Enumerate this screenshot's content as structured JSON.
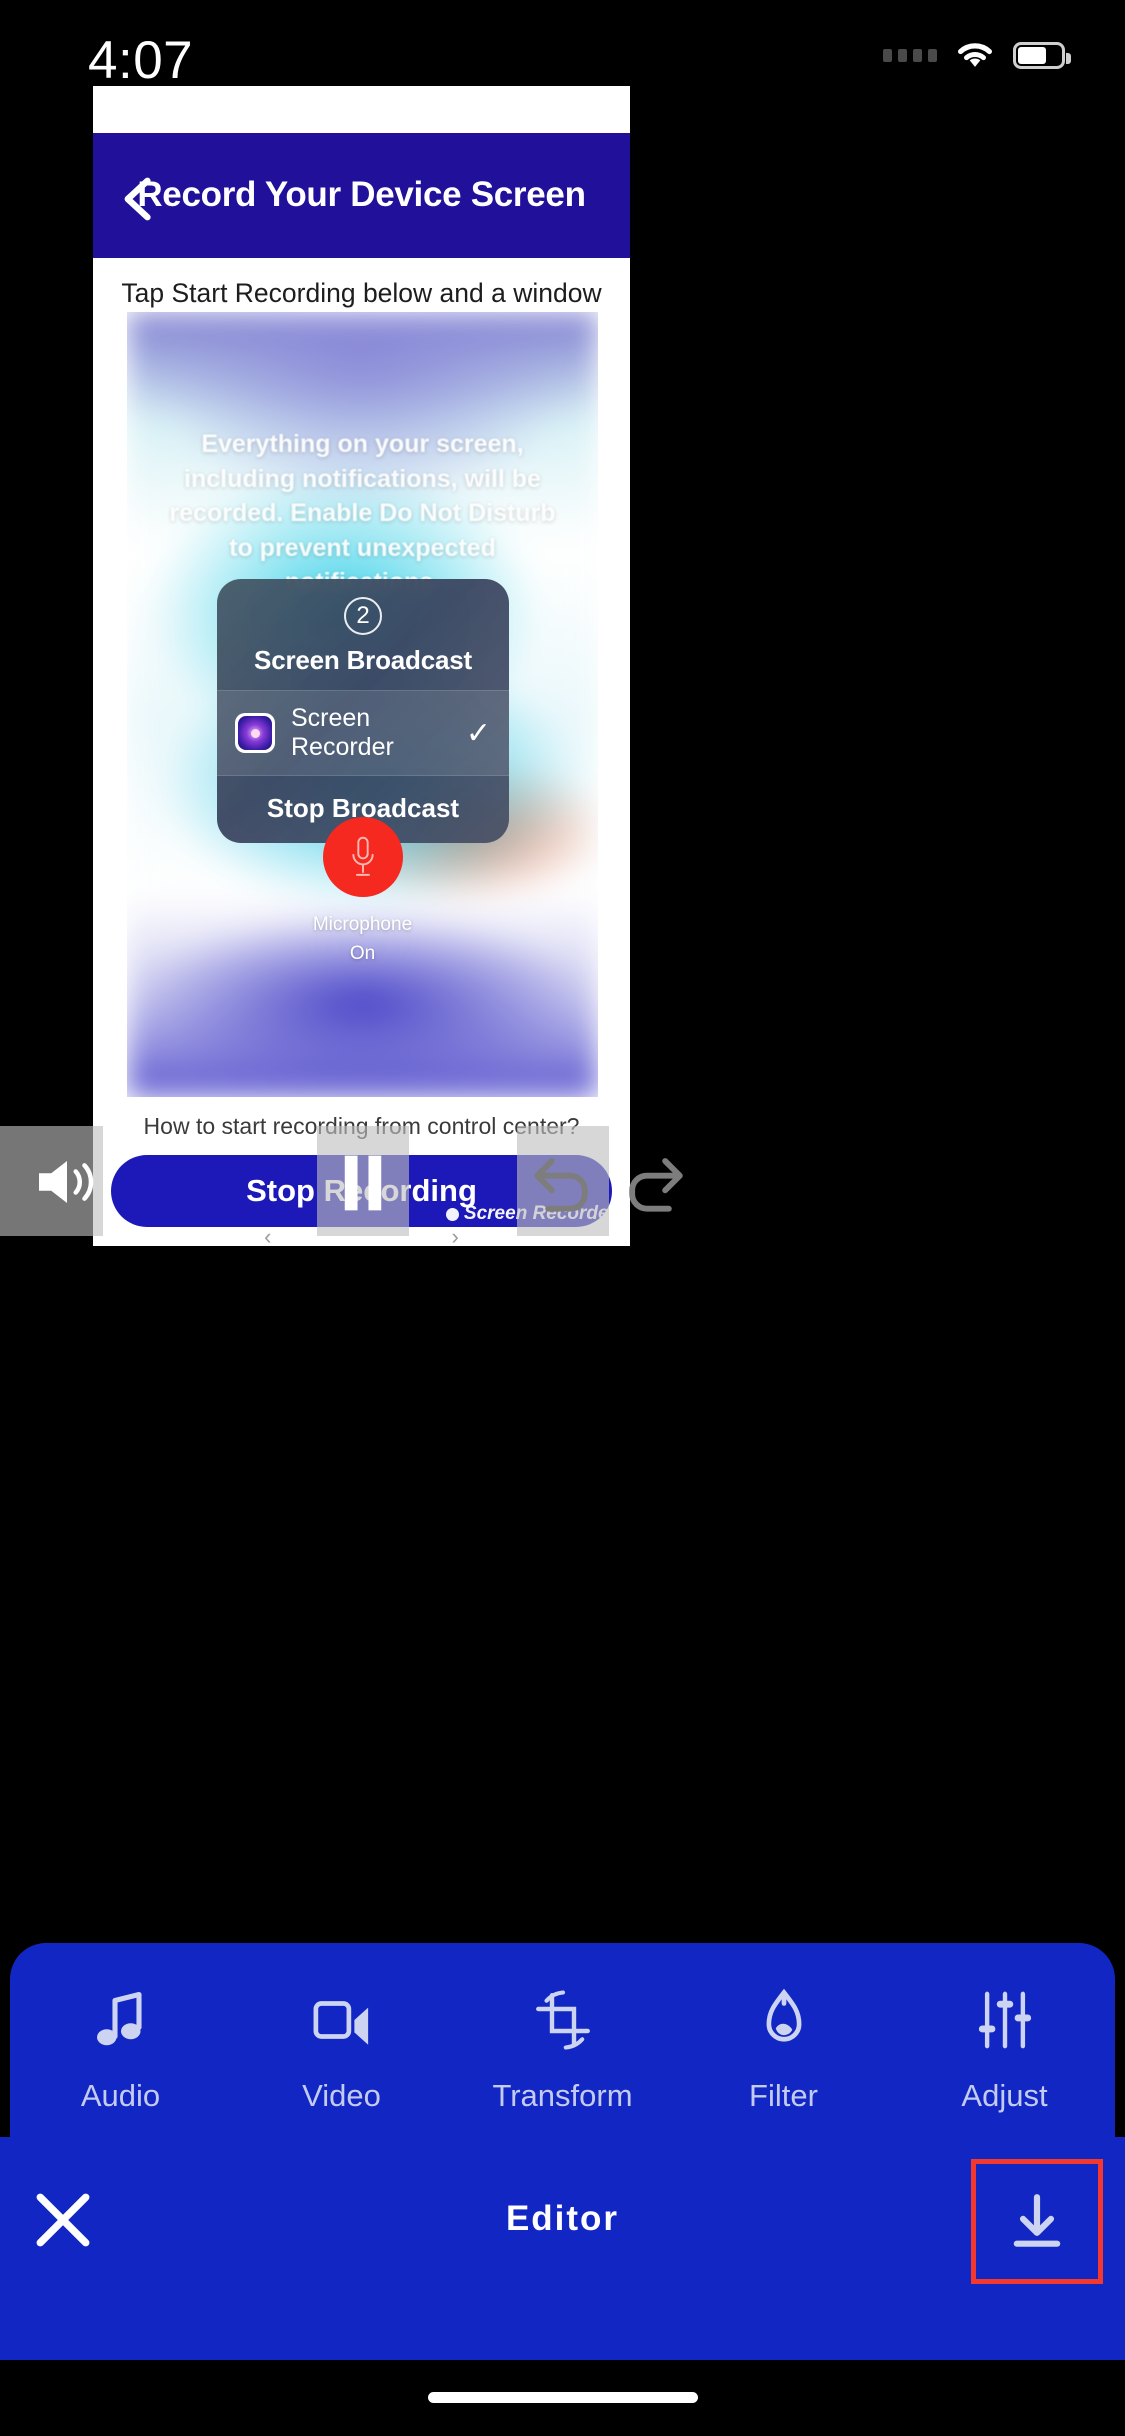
{
  "status_bar": {
    "time": "4:07",
    "wifi_icon": "wifi-icon",
    "battery_icon": "battery-icon",
    "signal_icon": "signal-dots-icon"
  },
  "preview": {
    "header": {
      "back_icon": "chevron-left-icon",
      "title": "Record Your Device Screen"
    },
    "instruction": "Tap Start Recording below and a window will pop-up. Then tap Start Broadcast.",
    "screenshot": {
      "overlay_text": "Everything on your screen, including notifications, will be recorded. Enable Do Not Disturb to prevent unexpected notifications.",
      "broadcast_panel": {
        "step_number": "2",
        "title": "Screen Broadcast",
        "app_name": "Screen Recorder",
        "app_icon": "screen-recorder-app-icon",
        "selected_check": "✓",
        "stop_label": "Stop Broadcast"
      },
      "microphone": {
        "icon": "microphone-icon",
        "label_line1": "Microphone",
        "label_line2": "On"
      }
    },
    "footer_hint": "How to start recording from control center?",
    "primary_button": "Stop Recording",
    "watermark": "Screen Recorder",
    "pager_prev": "‹",
    "pager_next": "›"
  },
  "playback_controls": {
    "volume_icon": "speaker-volume-icon",
    "pause_icon": "pause-icon",
    "undo_icon": "undo-icon",
    "redo_icon": "redo-icon"
  },
  "toolbar": {
    "items": [
      {
        "label": "Audio",
        "icon": "music-note-icon"
      },
      {
        "label": "Video",
        "icon": "video-camera-icon"
      },
      {
        "label": "Transform",
        "icon": "crop-rotate-icon"
      },
      {
        "label": "Filter",
        "icon": "filter-droplet-icon"
      },
      {
        "label": "Adjust",
        "icon": "sliders-icon"
      }
    ]
  },
  "bottom_bar": {
    "close_icon": "close-x-icon",
    "title": "Editor",
    "save_icon": "download-icon"
  },
  "colors": {
    "header_blue": "#211099",
    "toolbar_blue": "#1226c4",
    "accent_red": "#f5382e",
    "record_red": "#f5291f",
    "button_blue": "#1c19b8"
  }
}
